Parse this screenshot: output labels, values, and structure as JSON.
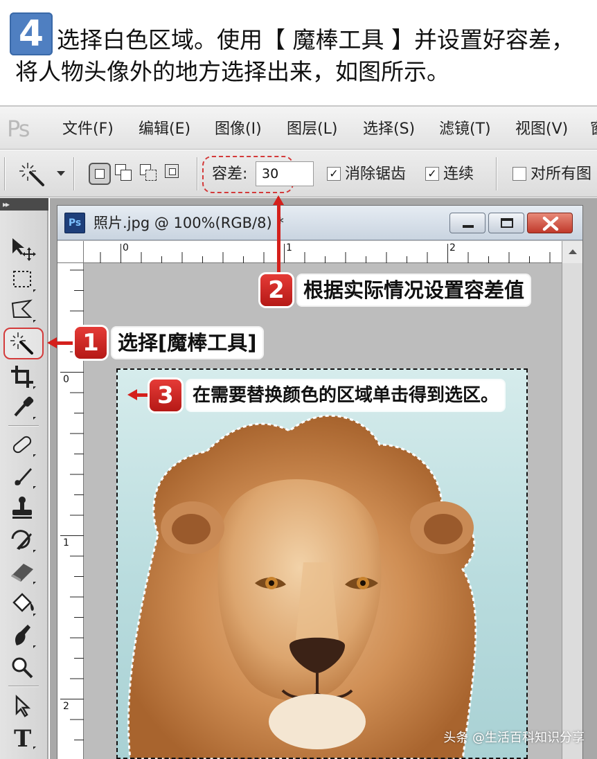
{
  "instruction": {
    "step_number": "4",
    "line1": "选择白色区域。使用【 魔棒工具 】并设置好容差，",
    "line2": "将人物头像外的地方选择出来，如图所示。"
  },
  "menubar": {
    "logo": "Ps",
    "items": [
      "文件(F)",
      "编辑(E)",
      "图像(I)",
      "图层(L)",
      "选择(S)",
      "滤镜(T)",
      "视图(V)",
      "窗"
    ]
  },
  "options_bar": {
    "tolerance_label": "容差:",
    "tolerance_value": "30",
    "anti_alias_label": "消除锯齿",
    "anti_alias_checked": true,
    "contiguous_label": "连续",
    "contiguous_checked": true,
    "sample_all_label": "对所有图",
    "sample_all_checked": false
  },
  "document": {
    "title": "照片.jpg @ 100%(RGB/8) *",
    "ruler_top_labels": [
      "0",
      "1",
      "2"
    ],
    "ruler_left_labels": [
      "0",
      "1",
      "2"
    ]
  },
  "callouts": [
    {
      "number": "1",
      "text": "选择[魔棒工具]"
    },
    {
      "number": "2",
      "text": "根据实际情况设置容差值"
    },
    {
      "number": "3",
      "text": "在需要替换颜色的区域单击得到选区。"
    }
  ],
  "watermark": "头条 @生活百科知识分享",
  "colors": {
    "accent_red": "#d4201c",
    "step_badge_blue": "#4f7fc1",
    "photo_background": "#b9dcde"
  },
  "icons": [
    "move-tool-icon",
    "marquee-tool-icon",
    "lasso-tool-icon",
    "magic-wand-tool-icon",
    "crop-tool-icon",
    "eyedropper-tool-icon",
    "healing-brush-icon",
    "brush-tool-icon",
    "clone-stamp-icon",
    "history-brush-icon",
    "eraser-tool-icon",
    "paint-bucket-icon",
    "smudge-tool-icon",
    "zoom-tool-icon",
    "path-selection-icon",
    "type-tool-icon"
  ]
}
